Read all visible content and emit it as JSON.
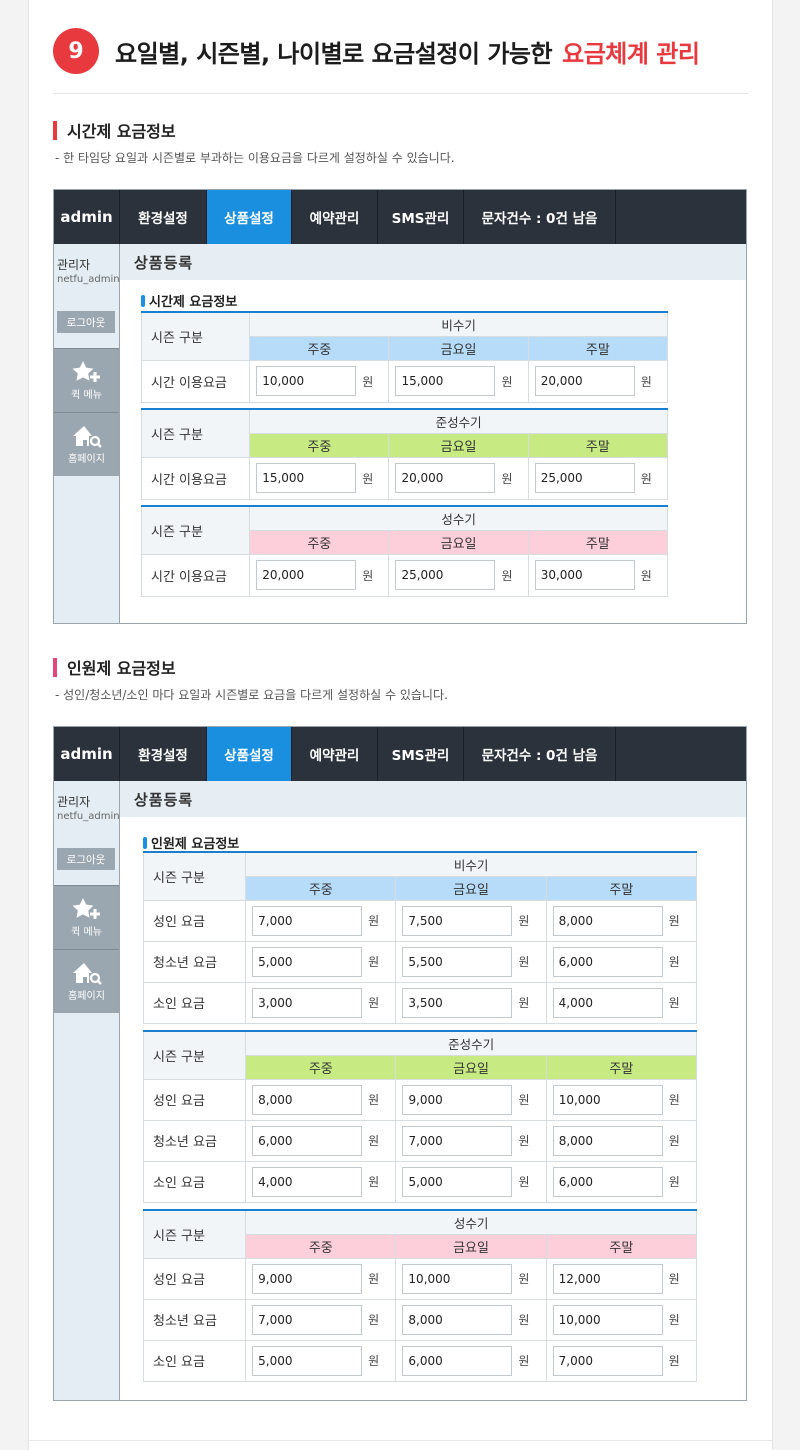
{
  "header": {
    "number": "9",
    "title": "요일별, 시즌별, 나이별로 요금설정이 가능한",
    "title_highlight": "요금체계 관리"
  },
  "time_section": {
    "title": "시간제 요금정보",
    "desc": "-  한 타임당 요일과 시즌별로 부과하는 이용요금을 다르게 설정하실 수 있습니다."
  },
  "person_section": {
    "title": "인원제 요금정보",
    "desc": "-  성인/청소년/소인 마다 요일과 시즌별로 요금을 다르게 설정하실 수 있습니다."
  },
  "admin": {
    "brand": "admin",
    "nav": [
      "환경설정",
      "상품설정",
      "예약관리",
      "SMS관리",
      "문자건수 : 0건 남음"
    ],
    "user_label": "관리자",
    "user_id": "netfu_admin",
    "logout": "로그아웃",
    "quick_menu": "퀵 메뉴",
    "homepage": "홈페이지",
    "content_title": "상품등록"
  },
  "common": {
    "season_col": "시즌 구분",
    "days": [
      "주중",
      "금요일",
      "주말"
    ],
    "won": "원"
  },
  "time_fee": {
    "box_title": "시간제 요금정보",
    "row_label": "시간 이용요금",
    "seasons": [
      {
        "name": "비수기",
        "values": [
          "10,000",
          "15,000",
          "20,000"
        ]
      },
      {
        "name": "준성수기",
        "values": [
          "15,000",
          "20,000",
          "25,000"
        ]
      },
      {
        "name": "성수기",
        "values": [
          "20,000",
          "25,000",
          "30,000"
        ]
      }
    ]
  },
  "person_fee": {
    "box_title": "인원제 요금정보",
    "row_labels": [
      "성인 요금",
      "청소년 요금",
      "소인 요금"
    ],
    "seasons": [
      {
        "name": "비수기",
        "values": [
          [
            "7,000",
            "7,500",
            "8,000"
          ],
          [
            "5,000",
            "5,500",
            "6,000"
          ],
          [
            "3,000",
            "3,500",
            "4,000"
          ]
        ]
      },
      {
        "name": "준성수기",
        "values": [
          [
            "8,000",
            "9,000",
            "10,000"
          ],
          [
            "6,000",
            "7,000",
            "8,000"
          ],
          [
            "4,000",
            "5,000",
            "6,000"
          ]
        ]
      },
      {
        "name": "성수기",
        "values": [
          [
            "9,000",
            "10,000",
            "12,000"
          ],
          [
            "7,000",
            "8,000",
            "10,000"
          ],
          [
            "5,000",
            "6,000",
            "7,000"
          ]
        ]
      }
    ]
  }
}
